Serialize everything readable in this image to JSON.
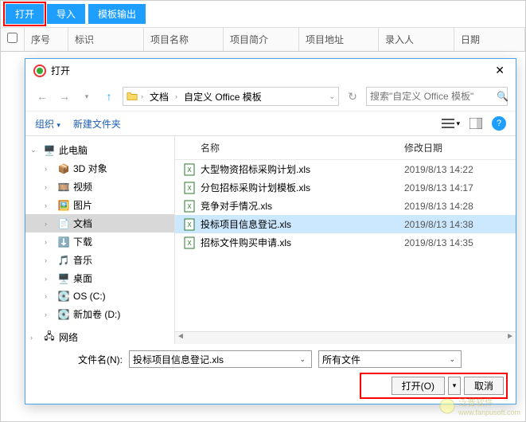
{
  "toolbar": {
    "open": "打开",
    "import": "导入",
    "template_out": "模板输出"
  },
  "grid": {
    "seq": "序号",
    "bid": "标识",
    "proj_name": "项目名称",
    "proj_intro": "项目简介",
    "proj_addr": "项目地址",
    "entrant": "录入人",
    "date": "日期"
  },
  "dialog": {
    "title": "打开",
    "path": {
      "seg1": "文档",
      "seg2": "自定义 Office 模板"
    },
    "search_placeholder": "搜索\"自定义 Office 模板\"",
    "org": "组织",
    "new_folder": "新建文件夹",
    "col_name": "名称",
    "col_date": "修改日期",
    "tree": {
      "this_pc": "此电脑",
      "objects3d": "3D 对象",
      "video": "视频",
      "pictures": "图片",
      "documents": "文档",
      "downloads": "下载",
      "music": "音乐",
      "desktop": "桌面",
      "drive_c": "OS (C:)",
      "drive_d": "新加卷 (D:)",
      "network": "网络"
    },
    "files": [
      {
        "name": "大型物资招标采购计划.xls",
        "date": "2019/8/13 14:22"
      },
      {
        "name": "分包招标采购计划模板.xls",
        "date": "2019/8/13 14:17"
      },
      {
        "name": "竞争对手情况.xls",
        "date": "2019/8/13 14:28"
      },
      {
        "name": "投标项目信息登记.xls",
        "date": "2019/8/13 14:38"
      },
      {
        "name": "招标文件购买申请.xls",
        "date": "2019/8/13 14:35"
      }
    ],
    "filename_label": "文件名(N):",
    "filename_value": "投标项目信息登记.xls",
    "filter": "所有文件",
    "open_btn": "打开(O)",
    "cancel_btn": "取消"
  },
  "watermark": {
    "text": "泛普软件",
    "url": "www.fanpusoft.com"
  }
}
